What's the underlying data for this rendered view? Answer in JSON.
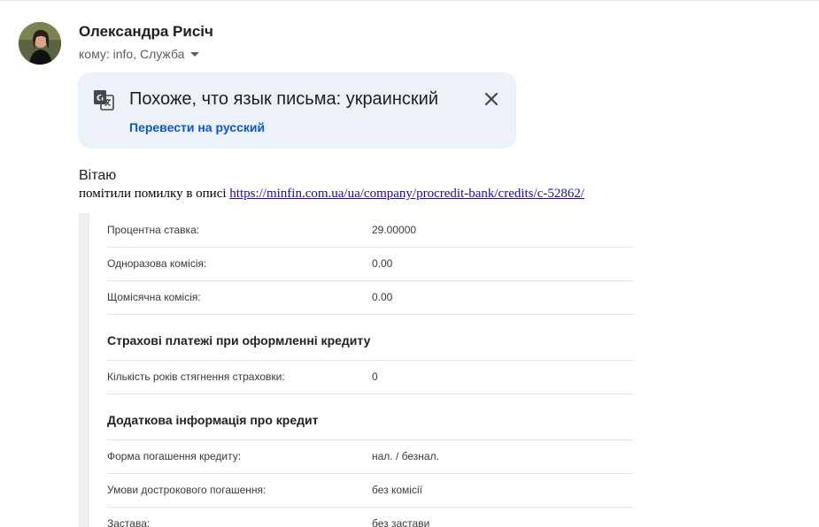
{
  "sender": {
    "name": "Олександра Рисіч",
    "recipients": "кому: info, Служба"
  },
  "translate_banner": {
    "title": "Похоже, что язык письма: украинский",
    "action": "Перевести на русский",
    "icon": "translate-icon",
    "close_icon": "close-icon"
  },
  "message": {
    "greeting": "Вітаю",
    "text": "помітили помилку в описі",
    "link": "https://minfin.com.ua/ua/company/procredit-bank/credits/c-52862/"
  },
  "embedded_screenshot": {
    "rows_top": [
      {
        "label": "Процентна ставка:",
        "value": "29.00000"
      },
      {
        "label": "Одноразова комісія:",
        "value": "0.00"
      },
      {
        "label": "Щомісячна комісія:",
        "value": "0.00"
      }
    ],
    "section_insurance": "Страхові платежі при оформленні кредиту",
    "rows_insurance": [
      {
        "label": "Кількість років стягнення страховки:",
        "value": "0"
      }
    ],
    "section_additional": "Додаткова інформація про кредит",
    "rows_additional": [
      {
        "label": "Форма погашення кредиту:",
        "value": "нал. / безнал."
      },
      {
        "label": "Умови дострокового погашення:",
        "value": "без комісії"
      },
      {
        "label": "Застава:",
        "value": "без застави"
      }
    ]
  },
  "colors": {
    "banner_bg": "#edf2fa",
    "link_blue": "#0b57d0",
    "body_link": "#1a0dab"
  }
}
